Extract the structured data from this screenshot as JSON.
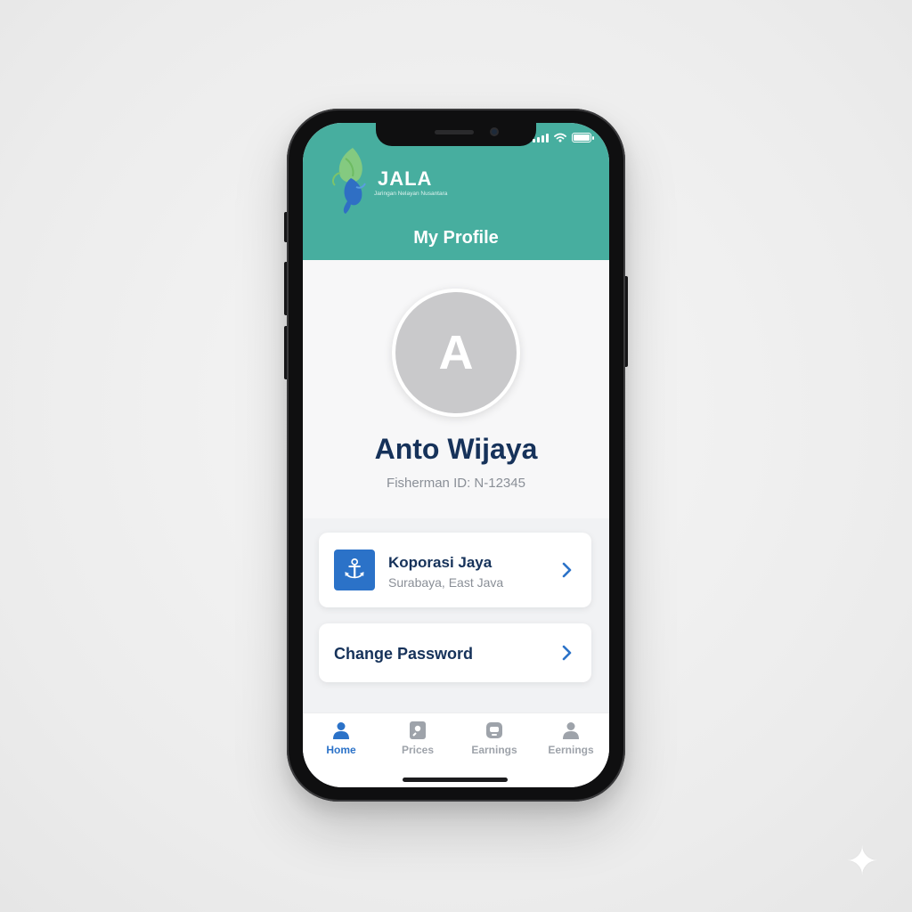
{
  "app": {
    "brand": "JALA",
    "tagline": "Jaringan Nelayan Nusantara",
    "page_title": "My Profile"
  },
  "profile": {
    "avatar_initial": "A",
    "name": "Anto Wijaya",
    "fisherman_id": "Fisherman ID: N-12345"
  },
  "cooperative": {
    "name": "Koporasi Jaya",
    "location": "Surabaya, East Java"
  },
  "actions": {
    "change_password": "Change Password"
  },
  "tabs": [
    {
      "label": "Home",
      "icon": "person-icon",
      "active": true
    },
    {
      "label": "Prices",
      "icon": "tag-icon",
      "active": false
    },
    {
      "label": "Earnings",
      "icon": "wallet-icon",
      "active": false
    },
    {
      "label": "Eernings",
      "icon": "person-icon",
      "active": false
    }
  ],
  "colors": {
    "header": "#47ae9f",
    "accent": "#2b72c8",
    "name_text": "#16325a"
  }
}
